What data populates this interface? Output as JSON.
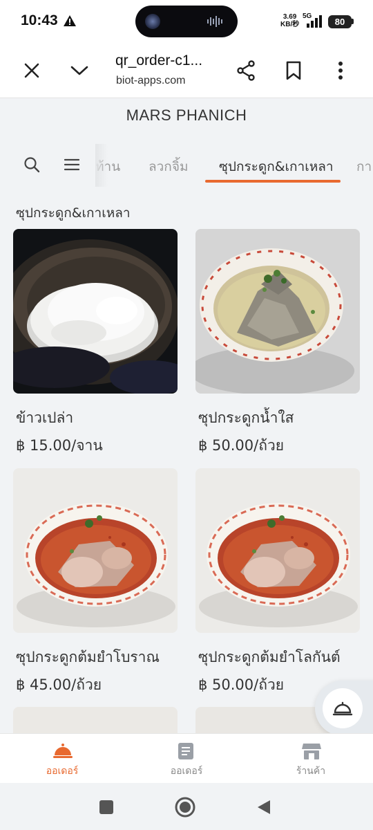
{
  "status_bar": {
    "time": "10:43",
    "net_speed_value": "3.69",
    "net_speed_unit": "KB/秒",
    "network": "5G",
    "battery": "80"
  },
  "browser": {
    "title": "qr_order-c1...",
    "domain": "biot-apps.com",
    "icons": [
      "close-icon",
      "chevron-down-icon",
      "share-icon",
      "bookmark-icon",
      "more-vert-icon"
    ]
  },
  "header": {
    "shop_name": "MARS PHANICH"
  },
  "categories": {
    "tabs": [
      {
        "label": "ท้าน",
        "active": false
      },
      {
        "label": "ลวกจิ้ม",
        "active": false
      },
      {
        "label": "ซุปกระดูก&เกาเหลา",
        "active": true
      },
      {
        "label": "กา",
        "active": false
      }
    ],
    "accent_color": "#e8692f"
  },
  "section": {
    "title": "ซุปกระดูก&เกาเหลา"
  },
  "products": [
    {
      "name": "ข้าวเปล่า",
      "price": "฿ 15.00/จาน",
      "image": "rice"
    },
    {
      "name": "ซุปกระดูกน้ำใส",
      "price": "฿ 50.00/ถ้วย",
      "image": "clear-soup"
    },
    {
      "name": "ซุปกระดูกต้มยำโบราณ",
      "price": "฿ 45.00/ถ้วย",
      "image": "tomyum-soup"
    },
    {
      "name": "ซุปกระดูกต้มยำโลกันต์",
      "price": "฿ 50.00/ถ้วย",
      "image": "tomyum-soup"
    }
  ],
  "bottom_nav": {
    "items": [
      {
        "label": "ออเดอร์",
        "icon": "order-bell-icon",
        "active": true
      },
      {
        "label": "ออเดอร์",
        "icon": "receipt-icon",
        "active": false
      },
      {
        "label": "ร้านค้า",
        "icon": "store-icon",
        "active": false
      }
    ]
  }
}
